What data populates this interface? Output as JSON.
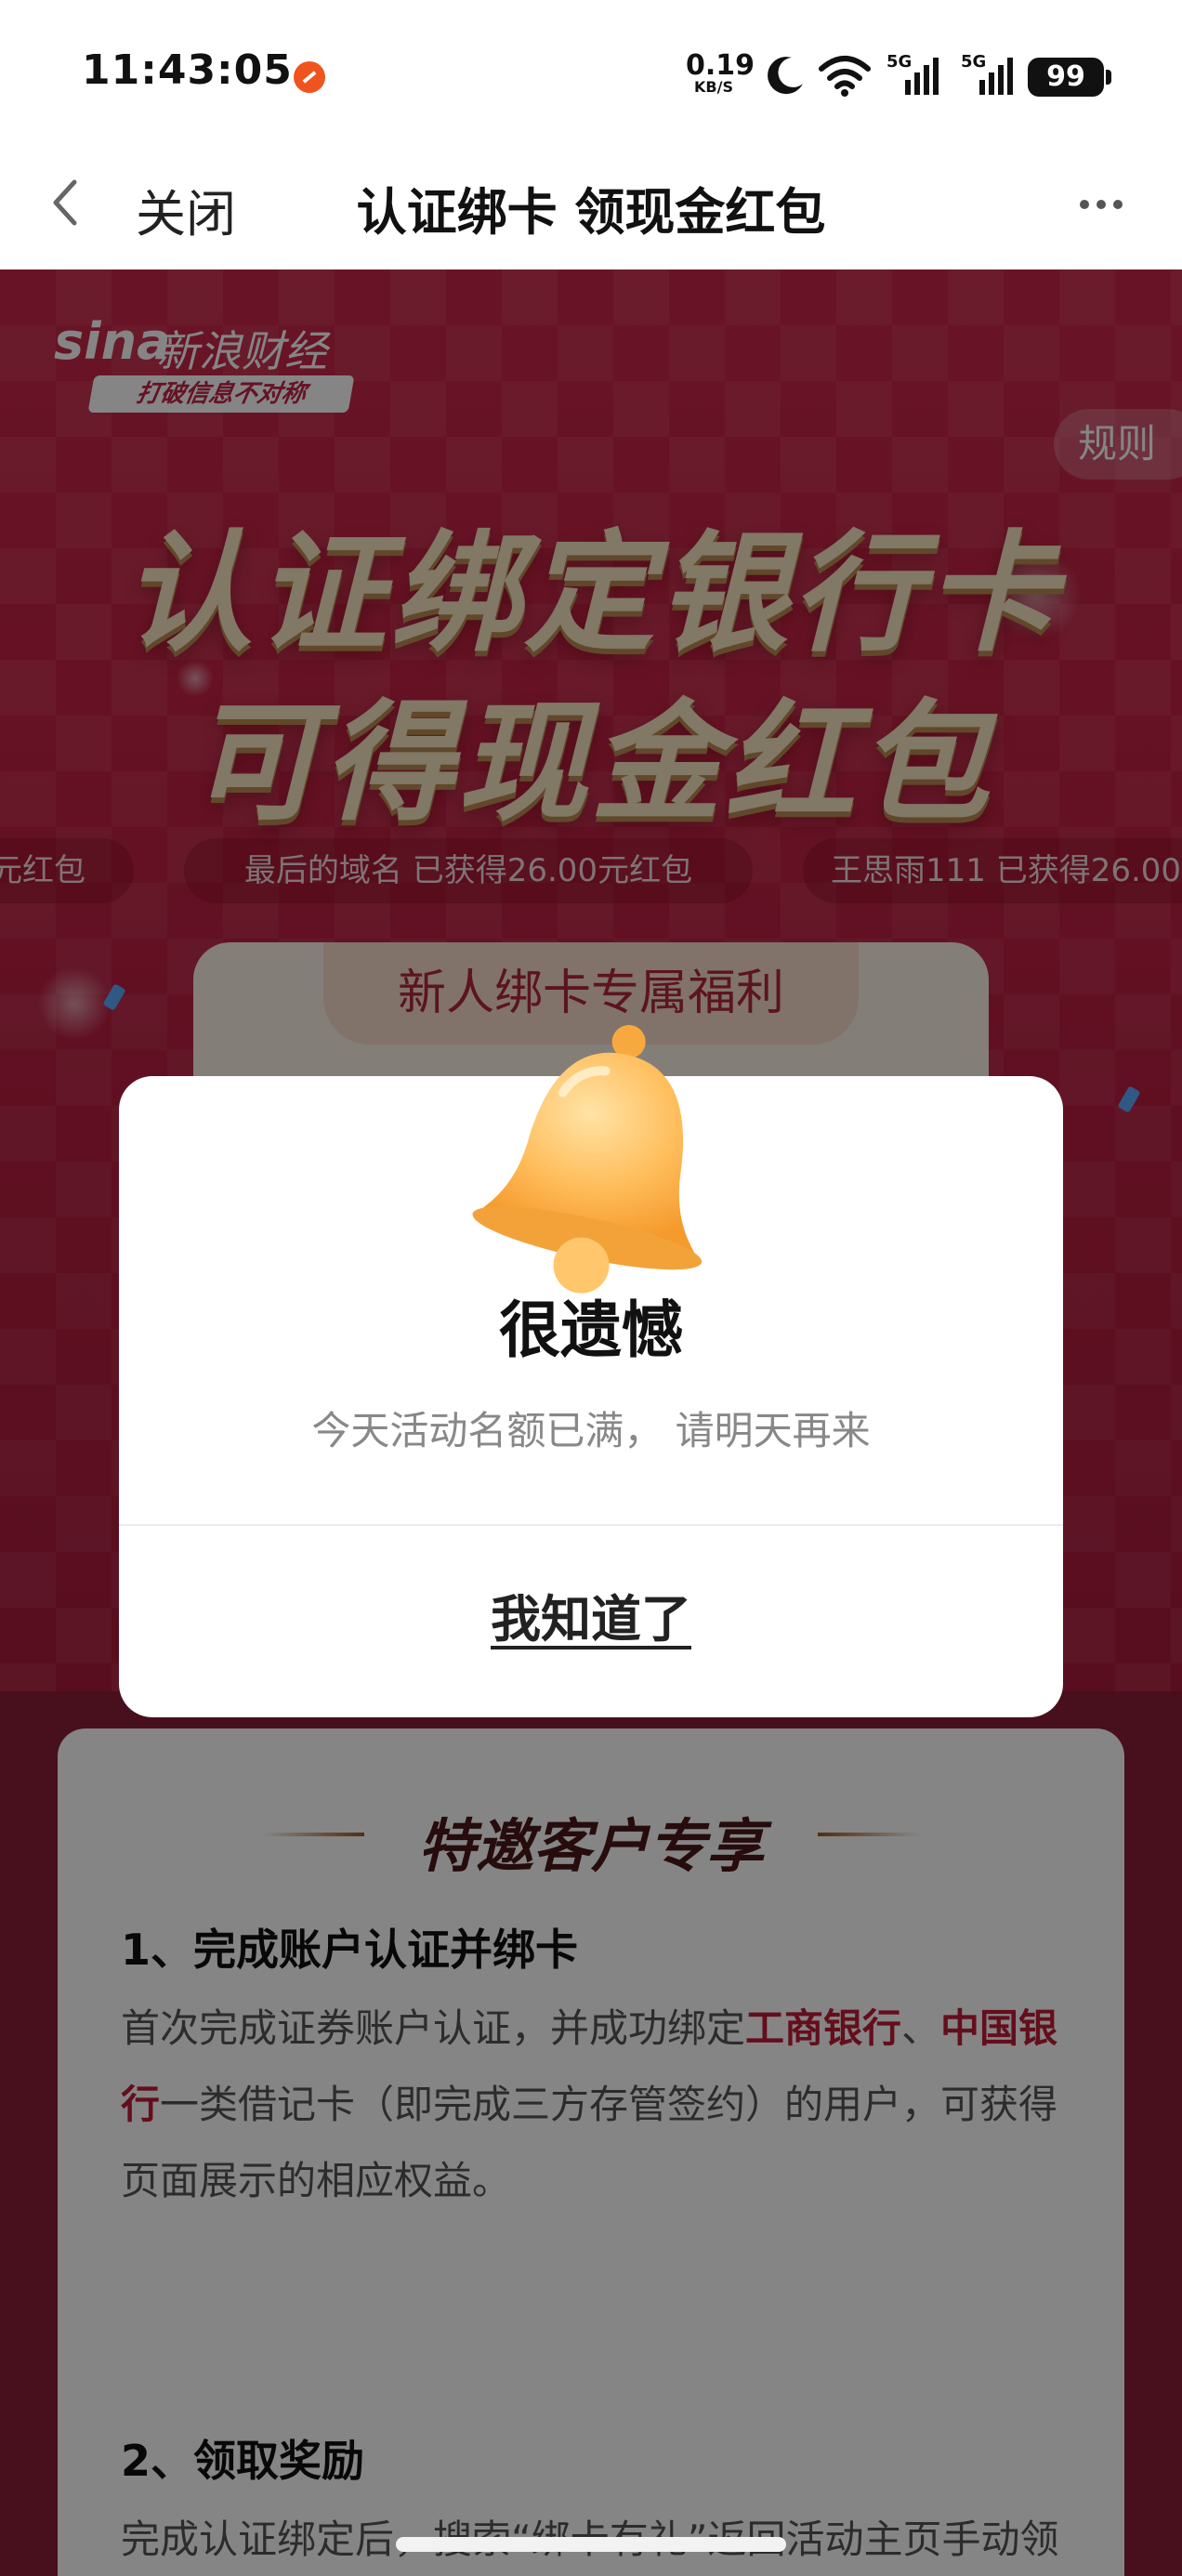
{
  "status_bar": {
    "time": "11:43:05",
    "net_speed_value": "0.19",
    "net_speed_unit": "KB/S",
    "signal_1_label": "5G",
    "signal_2_label": "5G",
    "battery": "99"
  },
  "header": {
    "back_icon": "chevron-left-icon",
    "close_label": "关闭",
    "title": "认证绑卡 领现金红包",
    "more_icon": "more-horizontal-icon"
  },
  "banner": {
    "logo_text": "sina",
    "logo_cn": "新浪财经",
    "logo_slogan": "打破信息不对称",
    "rules_label": "规则",
    "headline_line1": "认证绑定银行卡",
    "headline_line2": "可得现金红包",
    "ticker": [
      "元红包",
      "最后的域名 已获得26.00元红包",
      "王思雨111 已获得26.00"
    ],
    "benefit_tab": "新人绑卡专属福利"
  },
  "info": {
    "section_title": "特邀客户专享",
    "step1_title": "1、完成账户认证并绑卡",
    "step1_body_pre": "首次完成证券账户认证，并成功绑定",
    "step1_bank1": "工商银行",
    "step1_sep": "、",
    "step1_bank2": "中国银行",
    "step1_body_post": "一类借记卡（即完成三方存管签约）的用户，可获得页面展示的相应权益。",
    "step2_title": "2、领取奖励",
    "step2_body": "完成认证绑定后，搜索“绑卡有礼”返回活动主页手动领奖，奖励可通过以下路径进行查看：“点击左"
  },
  "dialog": {
    "icon": "bell-icon",
    "title": "很遗憾",
    "message": "今天活动名额已满， 请明天再来",
    "confirm_label": "我知道了"
  },
  "colors": {
    "banner_red": "#c32346",
    "highlight_red": "#c01c36",
    "headline_gold": "#f7e6c2"
  }
}
